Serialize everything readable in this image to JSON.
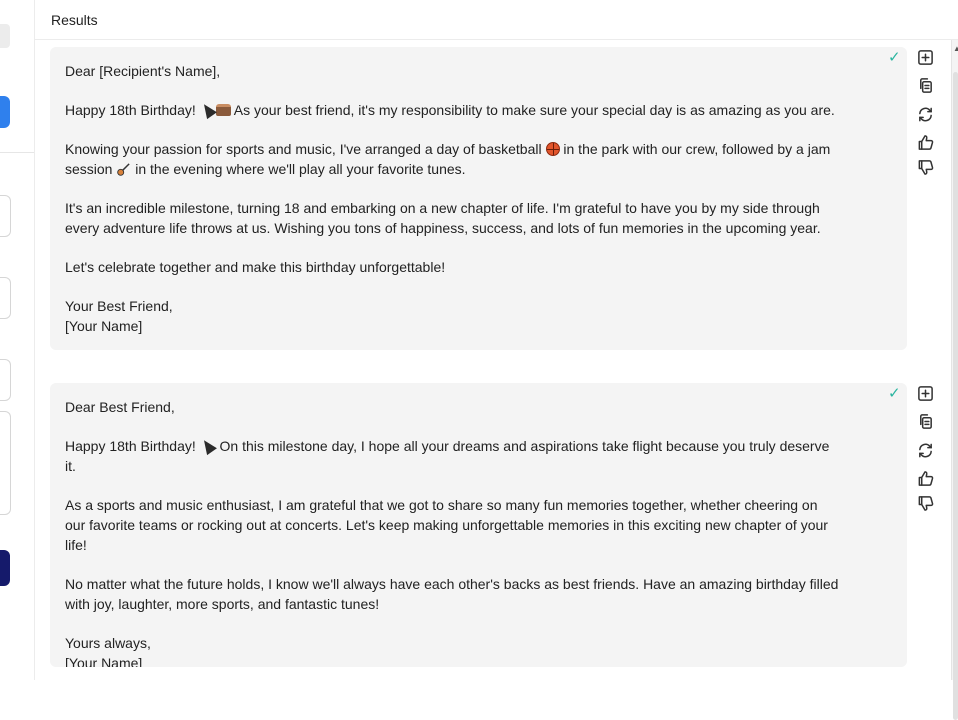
{
  "header": {
    "title": "Results"
  },
  "results": [
    {
      "lines": {
        "greeting": "Dear [Recipient's Name],",
        "p1_lead": "Happy 18th Birthday!",
        "p1_text": "As your best friend, it's my responsibility to make sure your special day is as amazing as you are.",
        "p2_a": "Knowing your passion for sports and music, I've arranged a day of basketball",
        "p2_b": "in the park with our crew, followed by a jam",
        "p2_c": "session",
        "p2_d": "in the evening where we'll play all your favorite tunes.",
        "p3_a": "It's an incredible milestone, turning 18 and embarking on a new chapter of life. I'm grateful to have you by my side through",
        "p3_b": "every adventure life throws at us. Wishing you tons of happiness, success, and lots of fun memories in the upcoming year.",
        "p4": "Let's celebrate together and make this birthday unforgettable!",
        "closing": "Your Best Friend,",
        "signature": "[Your Name]"
      }
    },
    {
      "lines": {
        "greeting": "Dear Best Friend,",
        "p1_lead": "Happy 18th Birthday!",
        "p1_a": "On this milestone day, I hope all your dreams and aspirations take flight because you truly deserve",
        "p1_b": "it.",
        "p2_a": "As a sports and music enthusiast, I am grateful that we got to share so many fun memories together, whether cheering on",
        "p2_b": "our favorite teams or rocking out at concerts. Let's keep making unforgettable memories in this exciting new chapter of your",
        "p2_c": "life!",
        "p3_a": "No matter what the future holds, I know we'll always have each other's backs as best friends. Have an amazing birthday filled",
        "p3_b": "with joy, laughter, more sports, and fantastic tunes!",
        "closing": "Yours always,",
        "signature": "[Your Name]"
      }
    }
  ],
  "actions": [
    "add-icon",
    "copy-icon",
    "regenerate-icon",
    "thumbs-up-icon",
    "thumbs-down-icon"
  ],
  "colors": {
    "check": "#2bb5a0",
    "card_bg": "#f4f4f4",
    "accent_blue": "#2f80ed",
    "navy": "#151a6b"
  }
}
